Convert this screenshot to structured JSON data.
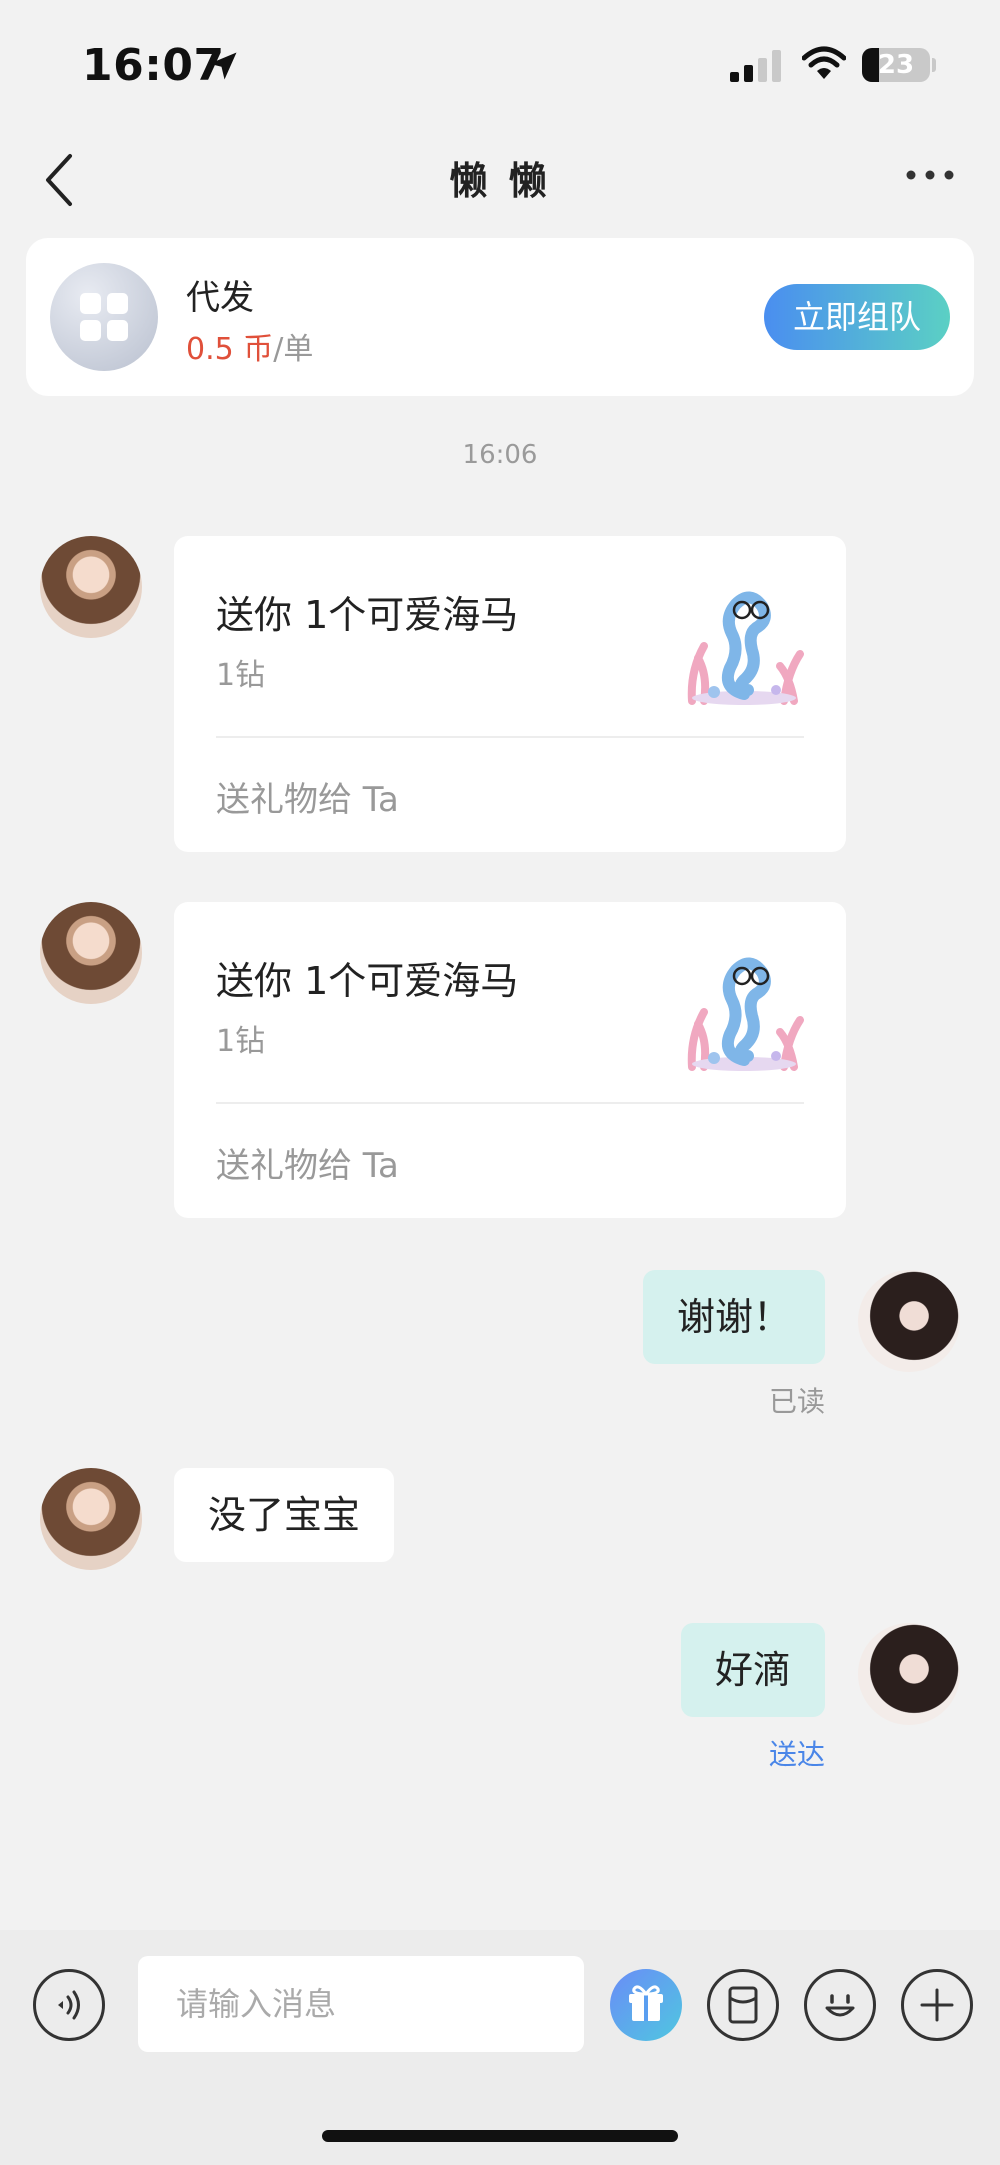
{
  "status_bar": {
    "time": "16:07",
    "battery": "23"
  },
  "nav": {
    "title": "懒 懒"
  },
  "order": {
    "name": "代发",
    "price": "0.5 币",
    "unit": "/单",
    "team_button": "立即组队"
  },
  "timestamp": "16:06",
  "messages": [
    {
      "type": "gift",
      "title": "送你 1个可爱海马",
      "value": "1钻",
      "action": "送礼物给 Ta"
    },
    {
      "type": "gift",
      "title": "送你 1个可爱海马",
      "value": "1钻",
      "action": "送礼物给 Ta"
    },
    {
      "type": "text",
      "from": "me",
      "text": "谢谢！",
      "receipt": "已读"
    },
    {
      "type": "text",
      "from": "them",
      "text": "没了宝宝"
    },
    {
      "type": "text",
      "from": "me",
      "text": "好滴",
      "receipt": "送达"
    }
  ],
  "input": {
    "placeholder": "请输入消息"
  },
  "colors": {
    "accent_red": "#e0503a",
    "mine_bubble": "#d5f1ee",
    "delivered_blue": "#4a86e8",
    "read_gray": "#999999"
  },
  "icons": [
    "location-arrow-icon",
    "signal-icon",
    "wifi-icon",
    "battery-icon",
    "back-chevron-icon",
    "more-dots-icon",
    "grid-app-icon",
    "seahorse-gift-icon",
    "voice-icon",
    "gift-icon",
    "red-packet-icon",
    "emoji-icon",
    "plus-icon"
  ]
}
